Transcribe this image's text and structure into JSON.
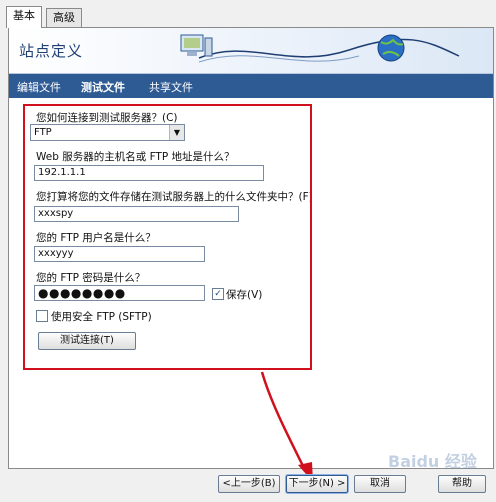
{
  "tabs": [
    {
      "label": "基本"
    },
    {
      "label": "高级"
    }
  ],
  "banner": {
    "title": "站点定义"
  },
  "nav": {
    "items": [
      {
        "label": "编辑文件"
      },
      {
        "label": "测试文件"
      },
      {
        "label": "共享文件"
      }
    ],
    "active_index": 1
  },
  "form": {
    "connect_label": "您如何连接到测试服务器？(C)",
    "connect_value": "FTP",
    "host_label": "Web 服务器的主机名或 FTP 地址是什么？",
    "host_value": "192.1.1.1",
    "folder_label": "您打算将您的文件存储在测试服务器上的什么文件夹中？(F)",
    "folder_value": "xxxspy",
    "user_label": "您的 FTP 用户名是什么？",
    "user_value": "xxxyyy",
    "password_label": "您的 FTP 密码是什么？",
    "password_mask": "●●●●●●●●",
    "save_label": "保存(V)",
    "save_checked": true,
    "sftp_label": "使用安全 FTP (SFTP)",
    "sftp_checked": false,
    "test_button": "测试连接(T)"
  },
  "footer": {
    "back": "<上一步(B)",
    "next": "下一步(N) >",
    "cancel": "取消",
    "help": "帮助"
  },
  "watermark": "Baidu 经验",
  "colors": {
    "accent": "#2f5b95",
    "highlight": "#d0101c"
  }
}
